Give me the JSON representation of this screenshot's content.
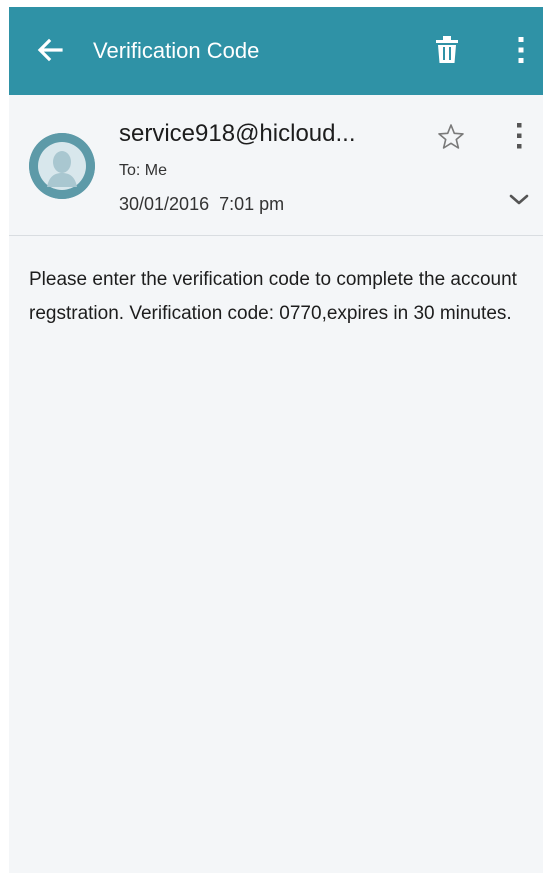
{
  "app_bar": {
    "title": "Verification Code",
    "back_icon": "arrow-left-icon",
    "delete_icon": "trash-icon",
    "more_icon": "more-vertical-icon",
    "background": "#2f92a6"
  },
  "message": {
    "sender": "service918@hicloud...",
    "recipient": "To: Me",
    "date": "30/01/2016  7:01 pm",
    "avatar_icon": "person-avatar-icon",
    "star_icon": "star-outline-icon",
    "more_icon": "more-vertical-icon",
    "expand_icon": "chevron-down-icon",
    "body": "Please enter the verification code to complete the account regstration. Verification code: 0770,expires in 30 minutes."
  }
}
